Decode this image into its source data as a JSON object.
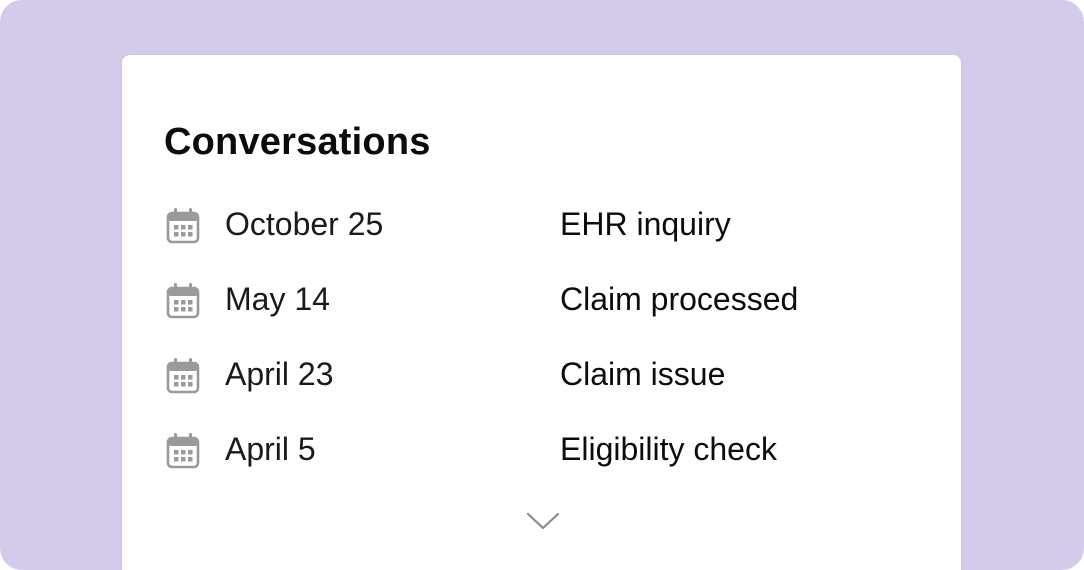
{
  "panel": {
    "title": "Conversations"
  },
  "conversations": [
    {
      "date": "October 25",
      "topic": "EHR inquiry"
    },
    {
      "date": "May 14",
      "topic": "Claim processed"
    },
    {
      "date": "April 23",
      "topic": "Claim issue"
    },
    {
      "date": "April 5",
      "topic": "Eligibility check"
    }
  ],
  "icons": {
    "row_icon": "calendar-icon",
    "expand_icon": "chevron-down-icon"
  },
  "colors": {
    "background": "#d4cbeb",
    "card": "#ffffff",
    "icon": "#9a9a9a",
    "text": "#0c0c0c"
  }
}
